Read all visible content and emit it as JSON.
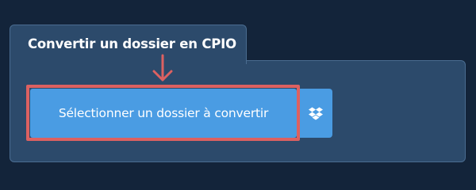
{
  "panel": {
    "title": "Convertir un dossier en CPIO"
  },
  "actions": {
    "select_folder_label": "Sélectionner un dossier à convertir",
    "dropbox_icon": "dropbox-icon"
  },
  "annotation": {
    "arrow_icon": "arrow-down-icon",
    "highlight_color": "#dc6161"
  },
  "colors": {
    "background": "#13243a",
    "panel": "#2c4a6b",
    "panel_border": "#4a6c90",
    "button": "#4a9ce3",
    "text": "#ffffff"
  }
}
